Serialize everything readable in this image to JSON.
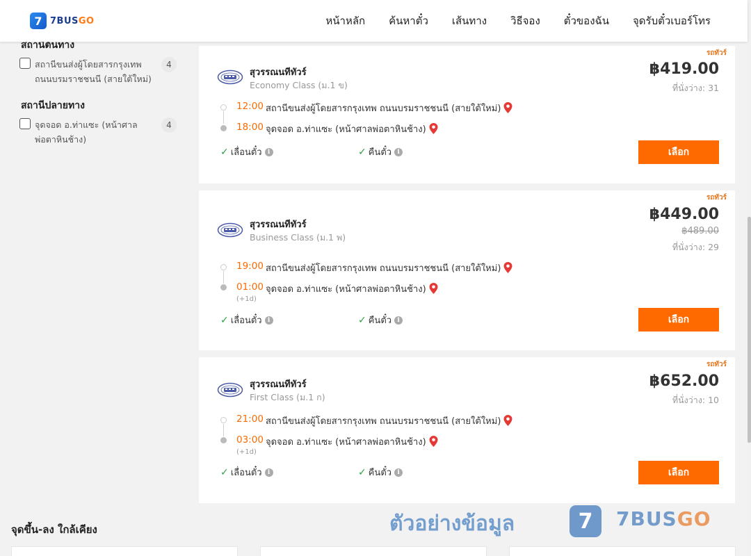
{
  "header": {
    "logo_mark": "7",
    "logo_text_main": "7BUS",
    "logo_text_accent": "GO",
    "nav": [
      "หน้าหลัก",
      "ค้นหาตั๋ว",
      "เส้นทาง",
      "วิธีจอง",
      "ตั๋วของฉัน",
      "จุดรับตั๋วเบอร์โทร"
    ]
  },
  "filters": {
    "origin_heading": "สถานีต้นทาง",
    "origin_items": [
      {
        "label": "สถานีขนส่งผู้โดยสารกรุงเทพ ถนนบรมราชชนนี (สายใต้ใหม่)",
        "count": "4"
      }
    ],
    "destination_heading": "สถานีปลายทาง",
    "destination_items": [
      {
        "label": "จุดจอด อ.ท่าแซะ (หน้าศาลพ่อตาหินช้าง)",
        "count": "4"
      }
    ]
  },
  "trips": [
    {
      "tag": "รถทัวร์",
      "operator": "สุวรรณนทีทัวร์",
      "class": "Economy Class (ม.1 ข)",
      "price": "฿419.00",
      "old_price": "",
      "seats": "ที่นั่งว่าง: 31",
      "depart_time": "12:00",
      "depart_place": "สถานีขนส่งผู้โดยสารกรุงเทพ ถนนบรมราชชนนี (สายใต้ใหม่)",
      "arrive_time": "18:00",
      "arrive_place": "จุดจอด อ.ท่าแซะ (หน้าศาลพ่อตาหินช้าง)",
      "plus_day": "",
      "feature_1": "เลื่อนตั๋ว",
      "feature_2": "คืนตั๋ว",
      "button": "เลือก"
    },
    {
      "tag": "รถทัวร์",
      "operator": "สุวรรณนทีทัวร์",
      "class": "Business Class (ม.1 พ)",
      "price": "฿449.00",
      "old_price": "฿489.00",
      "seats": "ที่นั่งว่าง: 29",
      "depart_time": "19:00",
      "depart_place": "สถานีขนส่งผู้โดยสารกรุงเทพ ถนนบรมราชชนนี (สายใต้ใหม่)",
      "arrive_time": "01:00",
      "arrive_place": "จุดจอด อ.ท่าแซะ (หน้าศาลพ่อตาหินช้าง)",
      "plus_day": "(+1d)",
      "feature_1": "เลื่อนตั๋ว",
      "feature_2": "คืนตั๋ว",
      "button": "เลือก"
    },
    {
      "tag": "รถทัวร์",
      "operator": "สุวรรณนทีทัวร์",
      "class": "First Class (ม.1 ก)",
      "price": "฿652.00",
      "old_price": "",
      "seats": "ที่นั่งว่าง: 10",
      "depart_time": "21:00",
      "depart_place": "สถานีขนส่งผู้โดยสารกรุงเทพ ถนนบรมราชชนนี (สายใต้ใหม่)",
      "arrive_time": "03:00",
      "arrive_place": "จุดจอด อ.ท่าแซะ (หน้าศาลพ่อตาหินช้าง)",
      "plus_day": "(+1d)",
      "feature_1": "เลื่อนตั๋ว",
      "feature_2": "คืนตั๋ว",
      "button": "เลือก"
    }
  ],
  "nearby": {
    "title": "จุดขึ้น-ลง ใกล้เคียง"
  },
  "watermark": {
    "text": "ตัวอย่างข้อมูล",
    "logo_mark": "7",
    "brand_main": "7BUS",
    "brand_accent": "GO"
  },
  "colors": {
    "accent": "#ff6a00",
    "tag": "#e8751a",
    "check": "#2da040",
    "pin": "#e53935",
    "brand_blue": "#1a3c8c"
  }
}
